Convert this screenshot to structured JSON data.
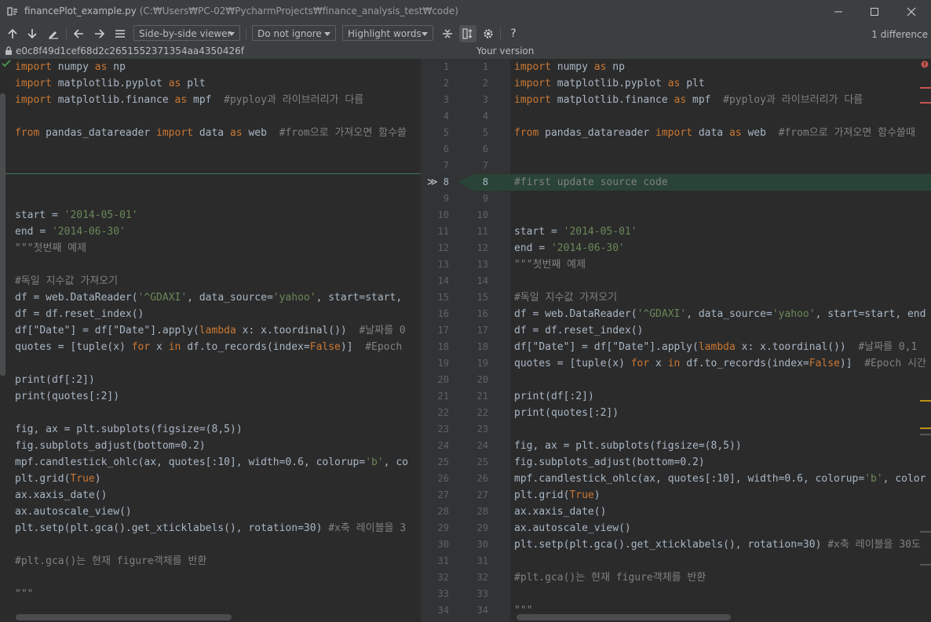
{
  "window": {
    "filename": "financePlot_example.py",
    "path": "(C:₩Users₩PC-02₩PycharmProjects₩finance_analysis_test₩code)"
  },
  "toolbar": {
    "viewer": "Side-by-side viewer",
    "ignore": "Do not ignore",
    "highlight": "Highlight words",
    "help": "?",
    "diff_count": "1 difference"
  },
  "info": {
    "left_revision": "e0c8f49d1cef68d2c2651552371354aa4350426f",
    "right_label": "Your version"
  },
  "left_lines": [
    {
      "n": 1,
      "t": "import numpy as np"
    },
    {
      "n": 2,
      "t": "import matplotlib.pyplot as plt"
    },
    {
      "n": 3,
      "t": "import matplotlib.finance as mpf  #pyploy과 라이브러리가 다름"
    },
    {
      "n": 4,
      "t": ""
    },
    {
      "n": 5,
      "t": "from pandas_datareader import data as web  #from으로 가져오면 함수쓸"
    },
    {
      "n": 6,
      "t": ""
    },
    {
      "n": 7,
      "t": ""
    },
    {
      "n": 8,
      "t": ""
    },
    {
      "n": 9,
      "t": ""
    },
    {
      "n": 10,
      "t": "start = '2014-05-01'"
    },
    {
      "n": 11,
      "t": "end = '2014-06-30'"
    },
    {
      "n": 12,
      "t": "\"\"\"첫번째 예제"
    },
    {
      "n": 13,
      "t": ""
    },
    {
      "n": 14,
      "t": "#독일 지수값 가져오기"
    },
    {
      "n": 15,
      "t": "df = web.DataReader('^GDAXI', data_source='yahoo', start=start,"
    },
    {
      "n": 16,
      "t": "df = df.reset_index()"
    },
    {
      "n": 17,
      "t": "df[\"Date\"] = df[\"Date\"].apply(lambda x: x.toordinal())  #날짜를 0"
    },
    {
      "n": 18,
      "t": "quotes = [tuple(x) for x in df.to_records(index=False)]  #Epoch"
    },
    {
      "n": 19,
      "t": ""
    },
    {
      "n": 20,
      "t": "print(df[:2])"
    },
    {
      "n": 21,
      "t": "print(quotes[:2])"
    },
    {
      "n": 22,
      "t": ""
    },
    {
      "n": 23,
      "t": "fig, ax = plt.subplots(figsize=(8,5))"
    },
    {
      "n": 24,
      "t": "fig.subplots_adjust(bottom=0.2)"
    },
    {
      "n": 25,
      "t": "mpf.candlestick_ohlc(ax, quotes[:10], width=0.6, colorup='b', co"
    },
    {
      "n": 26,
      "t": "plt.grid(True)"
    },
    {
      "n": 27,
      "t": "ax.xaxis_date()"
    },
    {
      "n": 28,
      "t": "ax.autoscale_view()"
    },
    {
      "n": 29,
      "t": "plt.setp(plt.gca().get_xticklabels(), rotation=30) #x축 레이블을 3"
    },
    {
      "n": 30,
      "t": ""
    },
    {
      "n": 31,
      "t": "#plt.gca()는 현재 figure객체를 반환"
    },
    {
      "n": 32,
      "t": ""
    },
    {
      "n": 33,
      "t": "\"\"\""
    },
    {
      "n": 34,
      "t": ""
    }
  ],
  "right_lines": [
    {
      "n": 1,
      "t": "import numpy as np"
    },
    {
      "n": 2,
      "t": "import matplotlib.pyplot as plt"
    },
    {
      "n": 3,
      "t": "import matplotlib.finance as mpf  #pyploy과 라이브러리가 다름"
    },
    {
      "n": 4,
      "t": ""
    },
    {
      "n": 5,
      "t": "from pandas_datareader import data as web  #from으로 가져오면 함수쓸때"
    },
    {
      "n": 6,
      "t": ""
    },
    {
      "n": 7,
      "t": ""
    },
    {
      "n": 8,
      "t": "#first update source code"
    },
    {
      "n": 9,
      "t": ""
    },
    {
      "n": 10,
      "t": ""
    },
    {
      "n": 11,
      "t": "start = '2014-05-01'"
    },
    {
      "n": 12,
      "t": "end = '2014-06-30'"
    },
    {
      "n": 13,
      "t": "\"\"\"첫번째 예제"
    },
    {
      "n": 14,
      "t": ""
    },
    {
      "n": 15,
      "t": "#독일 지수값 가져오기"
    },
    {
      "n": 16,
      "t": "df = web.DataReader('^GDAXI', data_source='yahoo', start=start, end"
    },
    {
      "n": 17,
      "t": "df = df.reset_index()"
    },
    {
      "n": 18,
      "t": "df[\"Date\"] = df[\"Date\"].apply(lambda x: x.toordinal())  #날짜를 0,1"
    },
    {
      "n": 19,
      "t": "quotes = [tuple(x) for x in df.to_records(index=False)]  #Epoch 시간"
    },
    {
      "n": 20,
      "t": ""
    },
    {
      "n": 21,
      "t": "print(df[:2])"
    },
    {
      "n": 22,
      "t": "print(quotes[:2])"
    },
    {
      "n": 23,
      "t": ""
    },
    {
      "n": 24,
      "t": "fig, ax = plt.subplots(figsize=(8,5))"
    },
    {
      "n": 25,
      "t": "fig.subplots_adjust(bottom=0.2)"
    },
    {
      "n": 26,
      "t": "mpf.candlestick_ohlc(ax, quotes[:10], width=0.6, colorup='b', color"
    },
    {
      "n": 27,
      "t": "plt.grid(True)"
    },
    {
      "n": 28,
      "t": "ax.xaxis_date()"
    },
    {
      "n": 29,
      "t": "ax.autoscale_view()"
    },
    {
      "n": 30,
      "t": "plt.setp(plt.gca().get_xticklabels(), rotation=30) #x축 레이블을 30도"
    },
    {
      "n": 31,
      "t": ""
    },
    {
      "n": 32,
      "t": "#plt.gca()는 현재 figure객체를 반환"
    },
    {
      "n": 33,
      "t": ""
    },
    {
      "n": 34,
      "t": "\"\"\""
    }
  ],
  "colors": {
    "background": "#2b2b2b",
    "gutter": "#313335",
    "chrome": "#3c3f41",
    "inserted_line": "#294436",
    "keyword": "#cc7832",
    "string": "#6a8759",
    "comment": "#808080",
    "text": "#a9b7c6",
    "error_marker": "#c75450",
    "warning_marker": "#be9117"
  }
}
